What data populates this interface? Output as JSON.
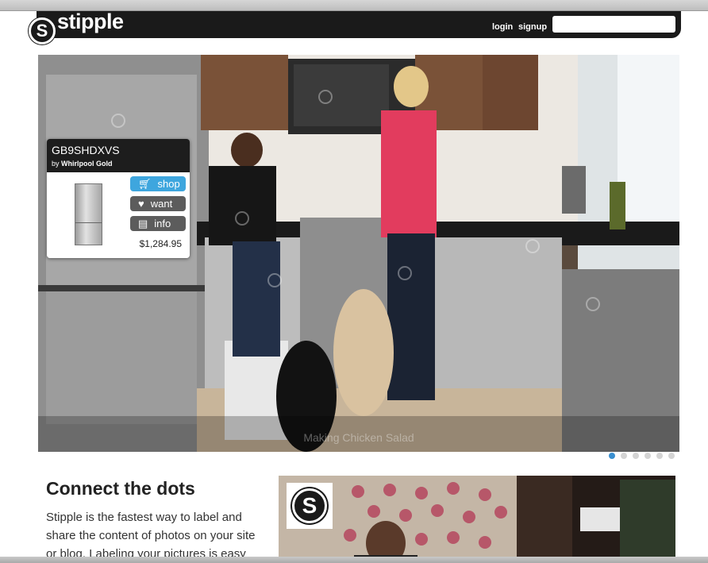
{
  "header": {
    "logo_glyph": "S",
    "logo_text": "stipple",
    "login_label": "login",
    "signup_label": "signup",
    "search_placeholder": ""
  },
  "hero": {
    "caption": "Making Chicken Salad"
  },
  "product_card": {
    "code": "GB9SHDXVS",
    "by_prefix": "by",
    "brand": "Whirlpool Gold",
    "shop_label": "shop",
    "want_label": "want",
    "info_label": "info",
    "price": "$1,284.95",
    "icons": {
      "shop": "cart-icon",
      "want": "heart-icon",
      "info": "info-card-icon"
    }
  },
  "pager": {
    "count": 6,
    "active_index": 0
  },
  "section": {
    "title": "Connect the dots",
    "body": "Stipple is the fastest way to label and share the content of photos on your site or blog. Labeling your pictures is easy"
  },
  "lower_logo_glyph": "S",
  "colors": {
    "accent": "#3ea6de",
    "header_bg": "#1a1a1a",
    "pager_active": "#3a8fd0"
  }
}
